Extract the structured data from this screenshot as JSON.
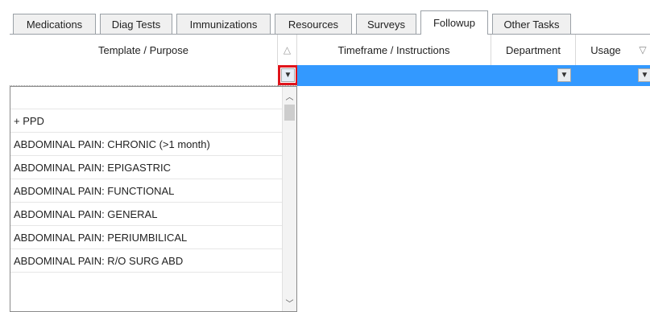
{
  "tabs": [
    {
      "label": "Medications",
      "active": false
    },
    {
      "label": "Diag Tests",
      "active": false
    },
    {
      "label": "Immunizations",
      "active": false
    },
    {
      "label": "Resources",
      "active": false
    },
    {
      "label": "Surveys",
      "active": false
    },
    {
      "label": "Followup",
      "active": true
    },
    {
      "label": "Other Tasks",
      "active": false
    }
  ],
  "grid": {
    "columns": {
      "template": "Template / Purpose",
      "timeframe": "Timeframe / Instructions",
      "department": "Department",
      "usage": "Usage"
    },
    "icons": {
      "sort": "sort-triangle-icon",
      "filter": "filter-icon",
      "dropdown": "chevron-down-icon"
    },
    "selection_color": "#3399ff",
    "highlight_color": "#e0141b"
  },
  "dropdown": {
    "items": [
      "",
      "+ PPD",
      "ABDOMINAL PAIN: CHRONIC  (>1 month)",
      "ABDOMINAL PAIN: EPIGASTRIC",
      "ABDOMINAL PAIN: FUNCTIONAL",
      "ABDOMINAL PAIN: GENERAL",
      "ABDOMINAL PAIN: PERIUMBILICAL",
      "ABDOMINAL PAIN: R/O SURG ABD"
    ]
  }
}
